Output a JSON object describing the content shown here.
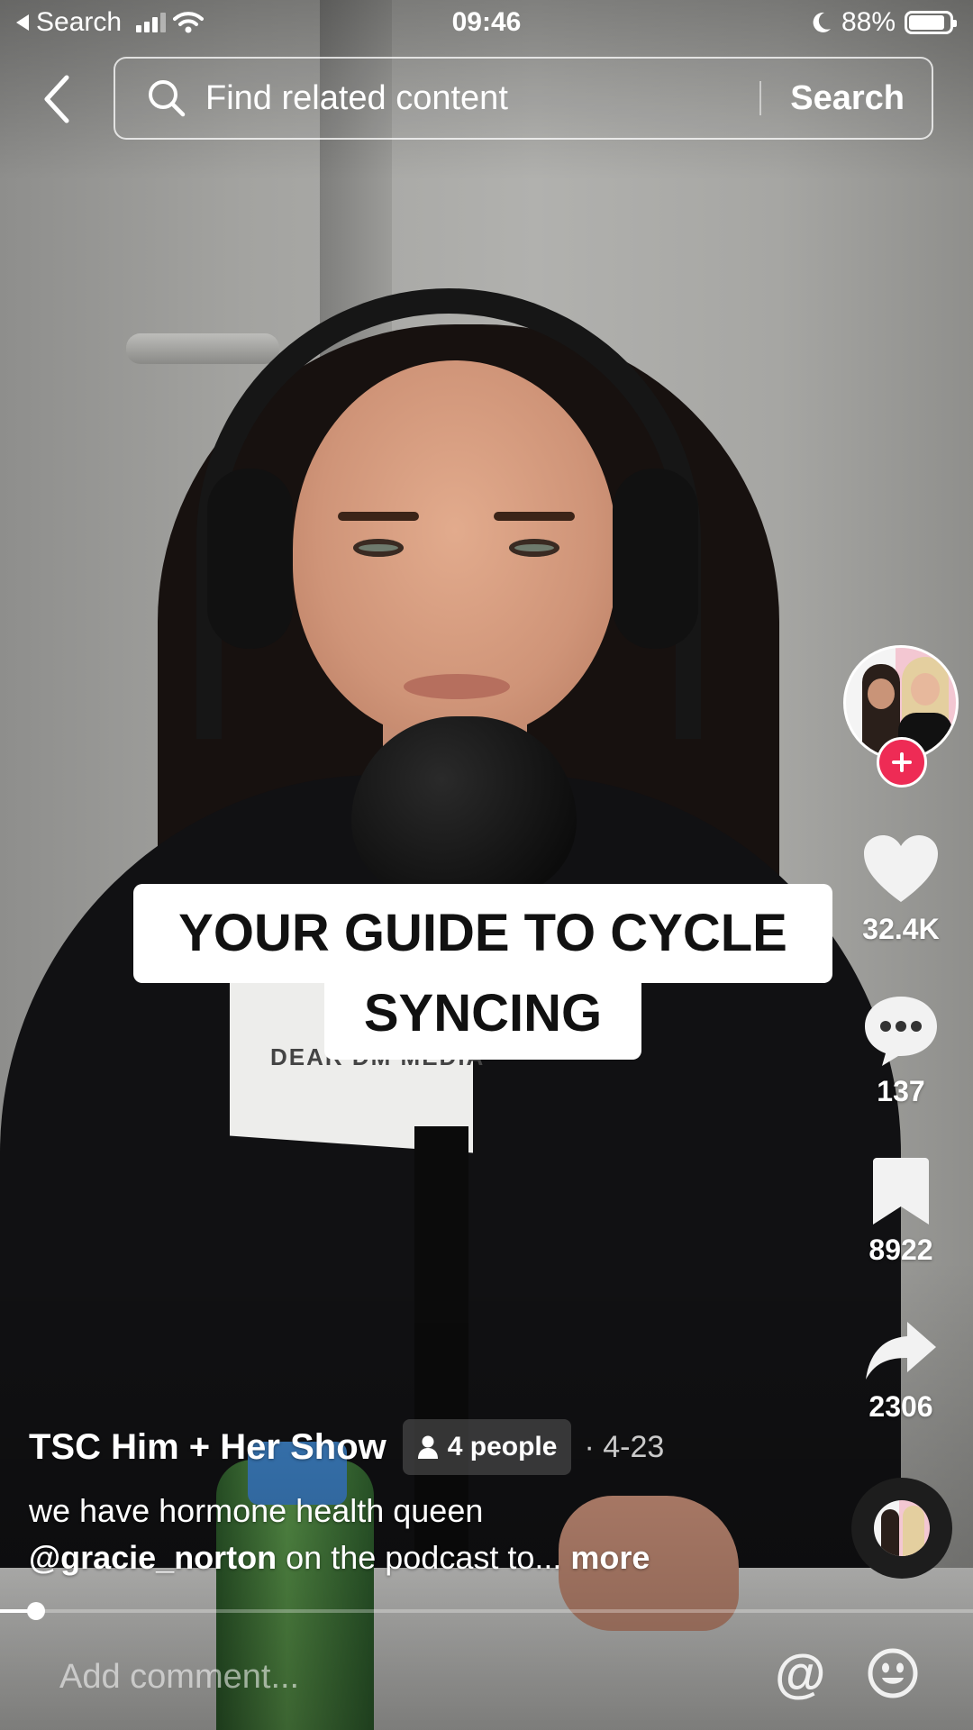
{
  "status_bar": {
    "back_app": "Search",
    "time": "09:46",
    "battery_percent": "88%",
    "battery_level": 0.88
  },
  "search": {
    "placeholder": "Find related content",
    "button_label": "Search"
  },
  "caption": {
    "line1": "YOUR GUIDE TO CYCLE",
    "line2": "SYNCING"
  },
  "actions": {
    "likes": "32.4K",
    "comments": "137",
    "saves": "8922",
    "shares": "2306"
  },
  "post": {
    "author": "TSC Him + Her Show",
    "people_tag": "4 people",
    "date": "· 4-23",
    "description_line1": "we have hormone health queen",
    "mention": "@gracie_norton",
    "description_line2_rest": " on the podcast to...",
    "more_label": " more"
  },
  "video_overlay": {
    "mic_flag_text": "DEAR DM MEDIA"
  },
  "playback": {
    "progress": 0.03
  },
  "comment": {
    "placeholder": "Add comment..."
  },
  "colors": {
    "follow_accent": "#ee2b55",
    "text": "#ffffff"
  }
}
